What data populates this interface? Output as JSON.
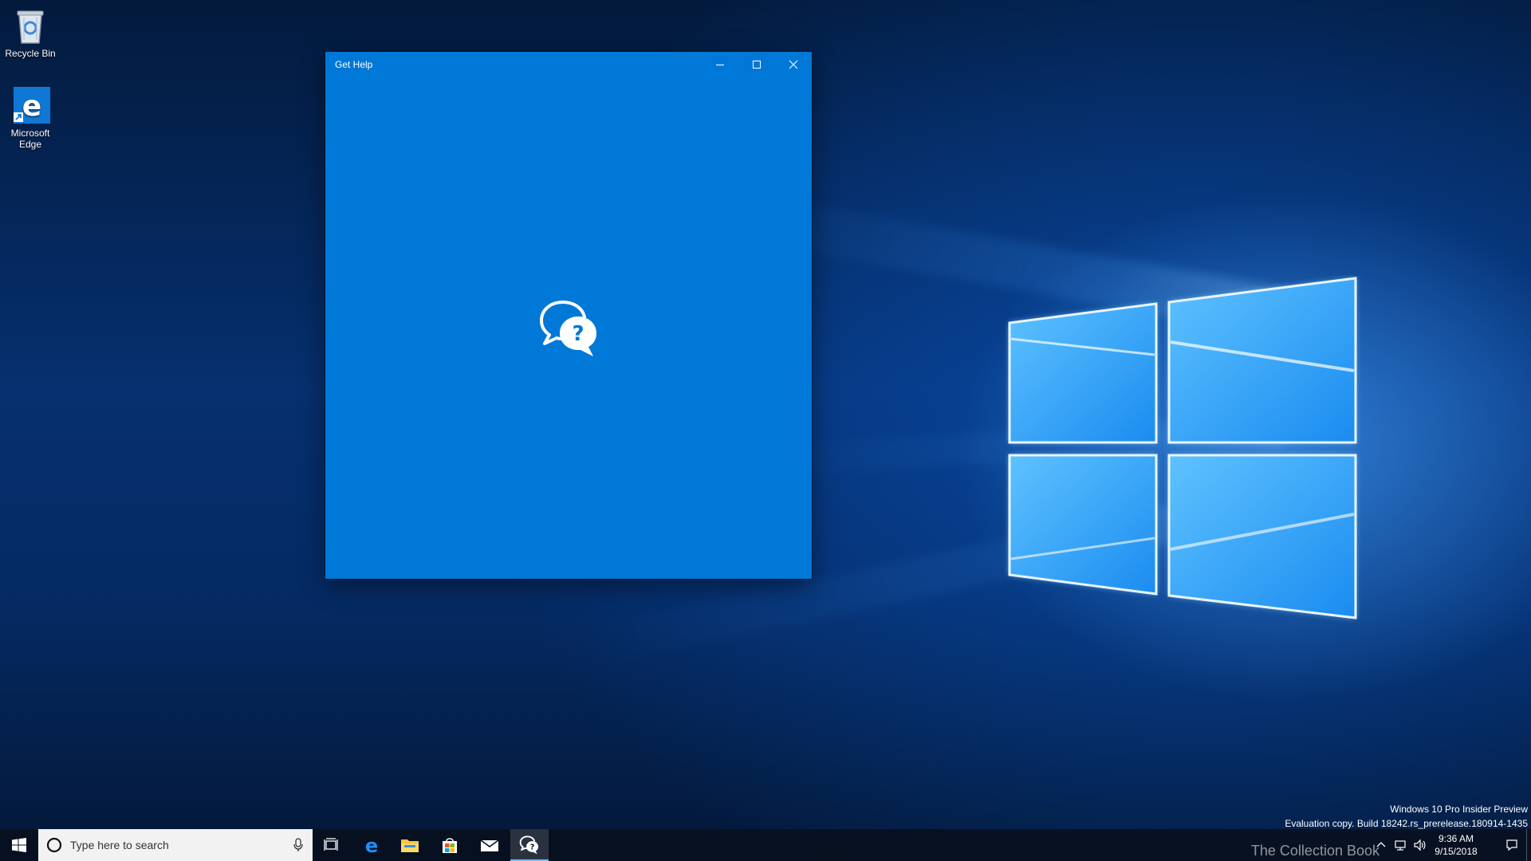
{
  "desktop": {
    "icons": [
      {
        "label": "Recycle Bin"
      },
      {
        "label": "Microsoft Edge"
      }
    ]
  },
  "window": {
    "title": "Get Help",
    "splash_icon": "chat-question-icon"
  },
  "watermark": {
    "line1": "Windows 10 Pro Insider Preview",
    "line2": "Evaluation copy. Build 18242.rs_prerelease.180914-1435"
  },
  "taskbar": {
    "search_placeholder": "Type here to search",
    "pinned": [
      {
        "name": "task-view",
        "icon": "task-view-icon"
      },
      {
        "name": "edge",
        "icon": "edge-icon"
      },
      {
        "name": "file-explorer",
        "icon": "folder-icon"
      },
      {
        "name": "store",
        "icon": "store-icon"
      },
      {
        "name": "mail",
        "icon": "mail-icon"
      },
      {
        "name": "get-help",
        "icon": "chat-question-icon",
        "active": true
      }
    ],
    "clock": {
      "time": "9:36 AM",
      "date": "9/15/2018"
    },
    "watermark_overlay": "The Collection Book"
  },
  "colors": {
    "accent": "#0078d7",
    "taskbar": "#08101e"
  }
}
